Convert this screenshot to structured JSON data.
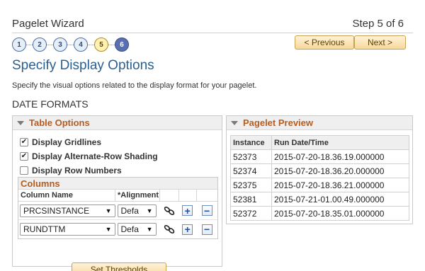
{
  "wizard": {
    "title": "Pagelet Wizard",
    "step_text": "Step 5 of 6"
  },
  "steps": [
    "1",
    "2",
    "3",
    "4",
    "5",
    "6"
  ],
  "nav": {
    "previous": "< Previous",
    "next": "Next >"
  },
  "page": {
    "title": "Specify Display Options",
    "description": "Specify the visual options related to the display format for your pagelet.",
    "section": "DATE FORMATS"
  },
  "table_options": {
    "header": "Table Options",
    "options": [
      {
        "label": "Display Gridlines",
        "checked": true
      },
      {
        "label": "Display Alternate-Row Shading",
        "checked": true
      },
      {
        "label": "Display Row Numbers",
        "checked": false
      }
    ],
    "columns": {
      "header": "Columns",
      "col_name_header": "Column Name",
      "alignment_header": "*Alignment",
      "rows": [
        {
          "column": "PRCSINSTANCE",
          "alignment": "Defa"
        },
        {
          "column": "RUNDTTM",
          "alignment": "Defa"
        }
      ]
    },
    "thresholds_label": "Set Thresholds"
  },
  "preview": {
    "header": "Pagelet Preview",
    "columns": [
      "Instance",
      "Run Date/Time"
    ],
    "rows": [
      [
        "52373",
        "2015-07-20-18.36.19.000000"
      ],
      [
        "52374",
        "2015-07-20-18.36.20.000000"
      ],
      [
        "52375",
        "2015-07-20-18.36.21.000000"
      ],
      [
        "52381",
        "2015-07-21-01.00.49.000000"
      ],
      [
        "52372",
        "2015-07-20-18.35.01.000000"
      ]
    ]
  },
  "icons": {
    "add": "+",
    "remove": "−",
    "check": "✔"
  }
}
